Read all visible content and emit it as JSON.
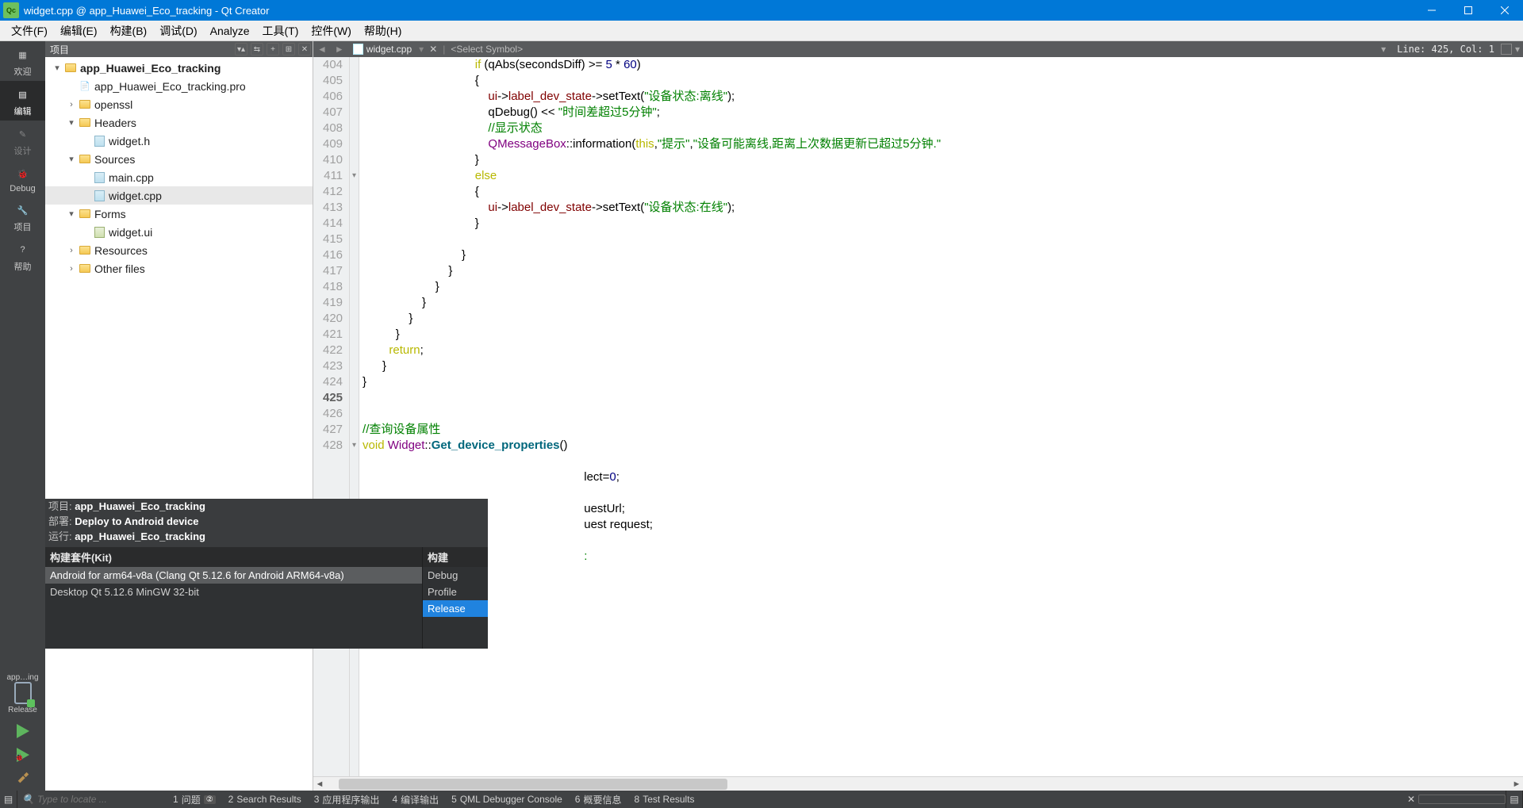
{
  "titlebar": {
    "title": "widget.cpp @ app_Huawei_Eco_tracking - Qt Creator"
  },
  "menu": {
    "file": "文件(F)",
    "edit": "编辑(E)",
    "build": "构建(B)",
    "debug": "调试(D)",
    "analyze": "Analyze",
    "tools": "工具(T)",
    "widgets": "控件(W)",
    "help": "帮助(H)"
  },
  "sidebar": {
    "welcome": "欢迎",
    "edit": "编辑",
    "design": "设计",
    "debug": "Debug",
    "projects": "项目",
    "help": "帮助",
    "target_abbrev": "app…ing",
    "target_conf": "Release"
  },
  "project_panel": {
    "title": "项目",
    "root": "app_Huawei_Eco_tracking",
    "pro_file": "app_Huawei_Eco_tracking.pro",
    "openssl": "openssl",
    "headers": "Headers",
    "widget_h": "widget.h",
    "sources": "Sources",
    "main_cpp": "main.cpp",
    "widget_cpp": "widget.cpp",
    "forms": "Forms",
    "widget_ui": "widget.ui",
    "resources": "Resources",
    "other_files": "Other files"
  },
  "editor_tabs": {
    "filename": "widget.cpp",
    "symbol": "<Select Symbol>",
    "linecol": "Line: 425, Col: 1"
  },
  "code": {
    "lines": [
      {
        "n": 404,
        "html": "                                  <span class='kw'>if</span> (qAbs(secondsDiff) &gt;= <span class='num'>5</span> * <span class='num'>60</span>)"
      },
      {
        "n": 405,
        "html": "                                  {"
      },
      {
        "n": 406,
        "html": "                                      <span class='mem'>ui</span>-&gt;<span class='mem'>label_dev_state</span>-&gt;setText(<span class='str'>\"设备状态:离线\"</span>);"
      },
      {
        "n": 407,
        "html": "                                      qDebug() &lt;&lt; <span class='str'>\"时间差超过5分钟\"</span>;"
      },
      {
        "n": 408,
        "html": "                                      <span class='cmt'>//显示状态</span>"
      },
      {
        "n": 409,
        "html": "                                      <span class='cls'>QMessageBox</span>::information(<span class='kw'>this</span>,<span class='str'>\"提示\"</span>,<span class='str'>\"设备可能离线,距离上次数据更新已超过5分钟.\"</span>"
      },
      {
        "n": 410,
        "html": "                                  }"
      },
      {
        "n": 411,
        "fold": "▾",
        "html": "                                  <span class='kw'>else</span>"
      },
      {
        "n": 412,
        "html": "                                  {"
      },
      {
        "n": 413,
        "html": "                                      <span class='mem'>ui</span>-&gt;<span class='mem'>label_dev_state</span>-&gt;setText(<span class='str'>\"设备状态:在线\"</span>);"
      },
      {
        "n": 414,
        "html": "                                  }"
      },
      {
        "n": 415,
        "html": ""
      },
      {
        "n": 416,
        "html": "                              }"
      },
      {
        "n": 417,
        "html": "                          }"
      },
      {
        "n": 418,
        "html": "                      }"
      },
      {
        "n": 419,
        "html": "                  }"
      },
      {
        "n": 420,
        "html": "              }"
      },
      {
        "n": 421,
        "html": "          }"
      },
      {
        "n": 422,
        "html": "        <span class='kw'>return</span>;"
      },
      {
        "n": 423,
        "html": "      }"
      },
      {
        "n": 424,
        "html": "}"
      },
      {
        "n": 425,
        "html": "",
        "cur": true
      },
      {
        "n": 426,
        "html": ""
      },
      {
        "n": 427,
        "html": "<span class='cmt'>//查询设备属性</span>"
      },
      {
        "n": 428,
        "fold": "▾",
        "html": "<span class='kw'>void</span> <span class='cls'>Widget</span>::<span class='fnd'>Get_device_properties</span>()"
      },
      {
        "n": "",
        "html": ""
      },
      {
        "n": "",
        "html": "                                                                   lect=<span class='num'>0</span>;"
      },
      {
        "n": "",
        "html": ""
      },
      {
        "n": "",
        "html": "                                                                   uestUrl;"
      },
      {
        "n": "",
        "html": "                                                                   uest request;"
      },
      {
        "n": "",
        "html": ""
      },
      {
        "n": "",
        "html": "                                                                   <span class='str'>:</span>"
      }
    ]
  },
  "target_popup": {
    "proj_label": "项目: ",
    "proj_val": "app_Huawei_Eco_tracking",
    "deploy_label": "部署: ",
    "deploy_val": "Deploy to Android device",
    "run_label": "运行: ",
    "run_val": "app_Huawei_Eco_tracking",
    "kits_header": "构建套件(Kit)",
    "build_header": "构建",
    "kit_android": "Android for arm64-v8a (Clang Qt 5.12.6 for Android ARM64-v8a)",
    "kit_desktop": "Desktop Qt 5.12.6 MinGW 32-bit",
    "build_debug": "Debug",
    "build_profile": "Profile",
    "build_release": "Release"
  },
  "statusbar": {
    "locate_ph": "Type to locate ...",
    "panes": [
      {
        "num": "1",
        "label": "问题",
        "badge": "②"
      },
      {
        "num": "2",
        "label": "Search Results"
      },
      {
        "num": "3",
        "label": "应用程序输出"
      },
      {
        "num": "4",
        "label": "编译输出"
      },
      {
        "num": "5",
        "label": "QML Debugger Console"
      },
      {
        "num": "6",
        "label": "概要信息"
      },
      {
        "num": "8",
        "label": "Test Results"
      }
    ]
  }
}
